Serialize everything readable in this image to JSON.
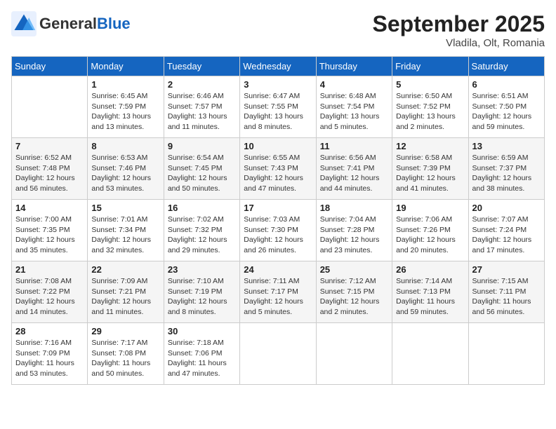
{
  "header": {
    "logo_general": "General",
    "logo_blue": "Blue",
    "month_year": "September 2025",
    "location": "Vladila, Olt, Romania"
  },
  "weekdays": [
    "Sunday",
    "Monday",
    "Tuesday",
    "Wednesday",
    "Thursday",
    "Friday",
    "Saturday"
  ],
  "weeks": [
    [
      {
        "day": "",
        "info": ""
      },
      {
        "day": "1",
        "info": "Sunrise: 6:45 AM\nSunset: 7:59 PM\nDaylight: 13 hours\nand 13 minutes."
      },
      {
        "day": "2",
        "info": "Sunrise: 6:46 AM\nSunset: 7:57 PM\nDaylight: 13 hours\nand 11 minutes."
      },
      {
        "day": "3",
        "info": "Sunrise: 6:47 AM\nSunset: 7:55 PM\nDaylight: 13 hours\nand 8 minutes."
      },
      {
        "day": "4",
        "info": "Sunrise: 6:48 AM\nSunset: 7:54 PM\nDaylight: 13 hours\nand 5 minutes."
      },
      {
        "day": "5",
        "info": "Sunrise: 6:50 AM\nSunset: 7:52 PM\nDaylight: 13 hours\nand 2 minutes."
      },
      {
        "day": "6",
        "info": "Sunrise: 6:51 AM\nSunset: 7:50 PM\nDaylight: 12 hours\nand 59 minutes."
      }
    ],
    [
      {
        "day": "7",
        "info": "Sunrise: 6:52 AM\nSunset: 7:48 PM\nDaylight: 12 hours\nand 56 minutes."
      },
      {
        "day": "8",
        "info": "Sunrise: 6:53 AM\nSunset: 7:46 PM\nDaylight: 12 hours\nand 53 minutes."
      },
      {
        "day": "9",
        "info": "Sunrise: 6:54 AM\nSunset: 7:45 PM\nDaylight: 12 hours\nand 50 minutes."
      },
      {
        "day": "10",
        "info": "Sunrise: 6:55 AM\nSunset: 7:43 PM\nDaylight: 12 hours\nand 47 minutes."
      },
      {
        "day": "11",
        "info": "Sunrise: 6:56 AM\nSunset: 7:41 PM\nDaylight: 12 hours\nand 44 minutes."
      },
      {
        "day": "12",
        "info": "Sunrise: 6:58 AM\nSunset: 7:39 PM\nDaylight: 12 hours\nand 41 minutes."
      },
      {
        "day": "13",
        "info": "Sunrise: 6:59 AM\nSunset: 7:37 PM\nDaylight: 12 hours\nand 38 minutes."
      }
    ],
    [
      {
        "day": "14",
        "info": "Sunrise: 7:00 AM\nSunset: 7:35 PM\nDaylight: 12 hours\nand 35 minutes."
      },
      {
        "day": "15",
        "info": "Sunrise: 7:01 AM\nSunset: 7:34 PM\nDaylight: 12 hours\nand 32 minutes."
      },
      {
        "day": "16",
        "info": "Sunrise: 7:02 AM\nSunset: 7:32 PM\nDaylight: 12 hours\nand 29 minutes."
      },
      {
        "day": "17",
        "info": "Sunrise: 7:03 AM\nSunset: 7:30 PM\nDaylight: 12 hours\nand 26 minutes."
      },
      {
        "day": "18",
        "info": "Sunrise: 7:04 AM\nSunset: 7:28 PM\nDaylight: 12 hours\nand 23 minutes."
      },
      {
        "day": "19",
        "info": "Sunrise: 7:06 AM\nSunset: 7:26 PM\nDaylight: 12 hours\nand 20 minutes."
      },
      {
        "day": "20",
        "info": "Sunrise: 7:07 AM\nSunset: 7:24 PM\nDaylight: 12 hours\nand 17 minutes."
      }
    ],
    [
      {
        "day": "21",
        "info": "Sunrise: 7:08 AM\nSunset: 7:22 PM\nDaylight: 12 hours\nand 14 minutes."
      },
      {
        "day": "22",
        "info": "Sunrise: 7:09 AM\nSunset: 7:21 PM\nDaylight: 12 hours\nand 11 minutes."
      },
      {
        "day": "23",
        "info": "Sunrise: 7:10 AM\nSunset: 7:19 PM\nDaylight: 12 hours\nand 8 minutes."
      },
      {
        "day": "24",
        "info": "Sunrise: 7:11 AM\nSunset: 7:17 PM\nDaylight: 12 hours\nand 5 minutes."
      },
      {
        "day": "25",
        "info": "Sunrise: 7:12 AM\nSunset: 7:15 PM\nDaylight: 12 hours\nand 2 minutes."
      },
      {
        "day": "26",
        "info": "Sunrise: 7:14 AM\nSunset: 7:13 PM\nDaylight: 11 hours\nand 59 minutes."
      },
      {
        "day": "27",
        "info": "Sunrise: 7:15 AM\nSunset: 7:11 PM\nDaylight: 11 hours\nand 56 minutes."
      }
    ],
    [
      {
        "day": "28",
        "info": "Sunrise: 7:16 AM\nSunset: 7:09 PM\nDaylight: 11 hours\nand 53 minutes."
      },
      {
        "day": "29",
        "info": "Sunrise: 7:17 AM\nSunset: 7:08 PM\nDaylight: 11 hours\nand 50 minutes."
      },
      {
        "day": "30",
        "info": "Sunrise: 7:18 AM\nSunset: 7:06 PM\nDaylight: 11 hours\nand 47 minutes."
      },
      {
        "day": "",
        "info": ""
      },
      {
        "day": "",
        "info": ""
      },
      {
        "day": "",
        "info": ""
      },
      {
        "day": "",
        "info": ""
      }
    ]
  ]
}
